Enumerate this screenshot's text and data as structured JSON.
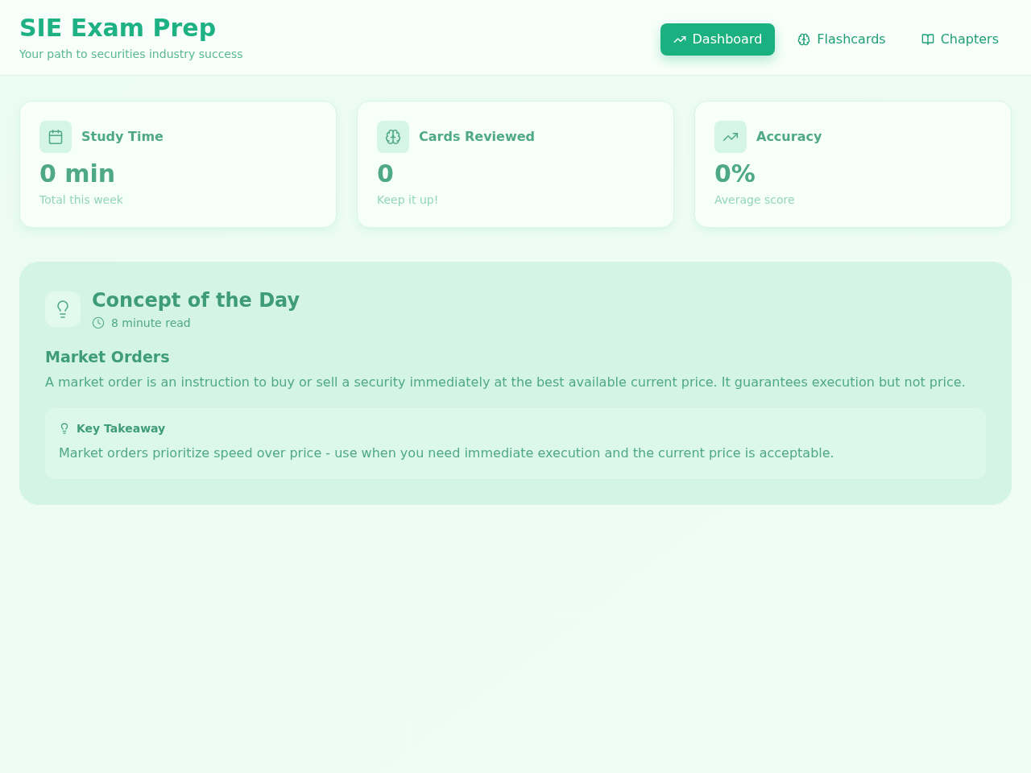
{
  "header": {
    "title": "SIE Exam Prep",
    "subtitle": "Your path to securities industry success"
  },
  "nav": [
    {
      "label": "Dashboard",
      "selected": true
    },
    {
      "label": "Flashcards",
      "selected": false
    },
    {
      "label": "Chapters",
      "selected": false
    }
  ],
  "stats": [
    {
      "label": "Study Time",
      "value": "0 min",
      "caption": "Total this week"
    },
    {
      "label": "Cards Reviewed",
      "value": "0",
      "caption": "Keep it up!"
    },
    {
      "label": "Accuracy",
      "value": "0%",
      "caption": "Average score"
    }
  ],
  "concept": {
    "title": "Concept of the Day",
    "read_time": "8 minute read",
    "heading": "Market Orders",
    "body": "A market order is an instruction to buy or sell a security immediately at the best available current price. It guarantees execution but not price.",
    "takeaway": {
      "label": "Key Takeaway",
      "text": "Market orders prioritize speed over price - use when you need immediate execution and the current price is acceptable."
    }
  }
}
